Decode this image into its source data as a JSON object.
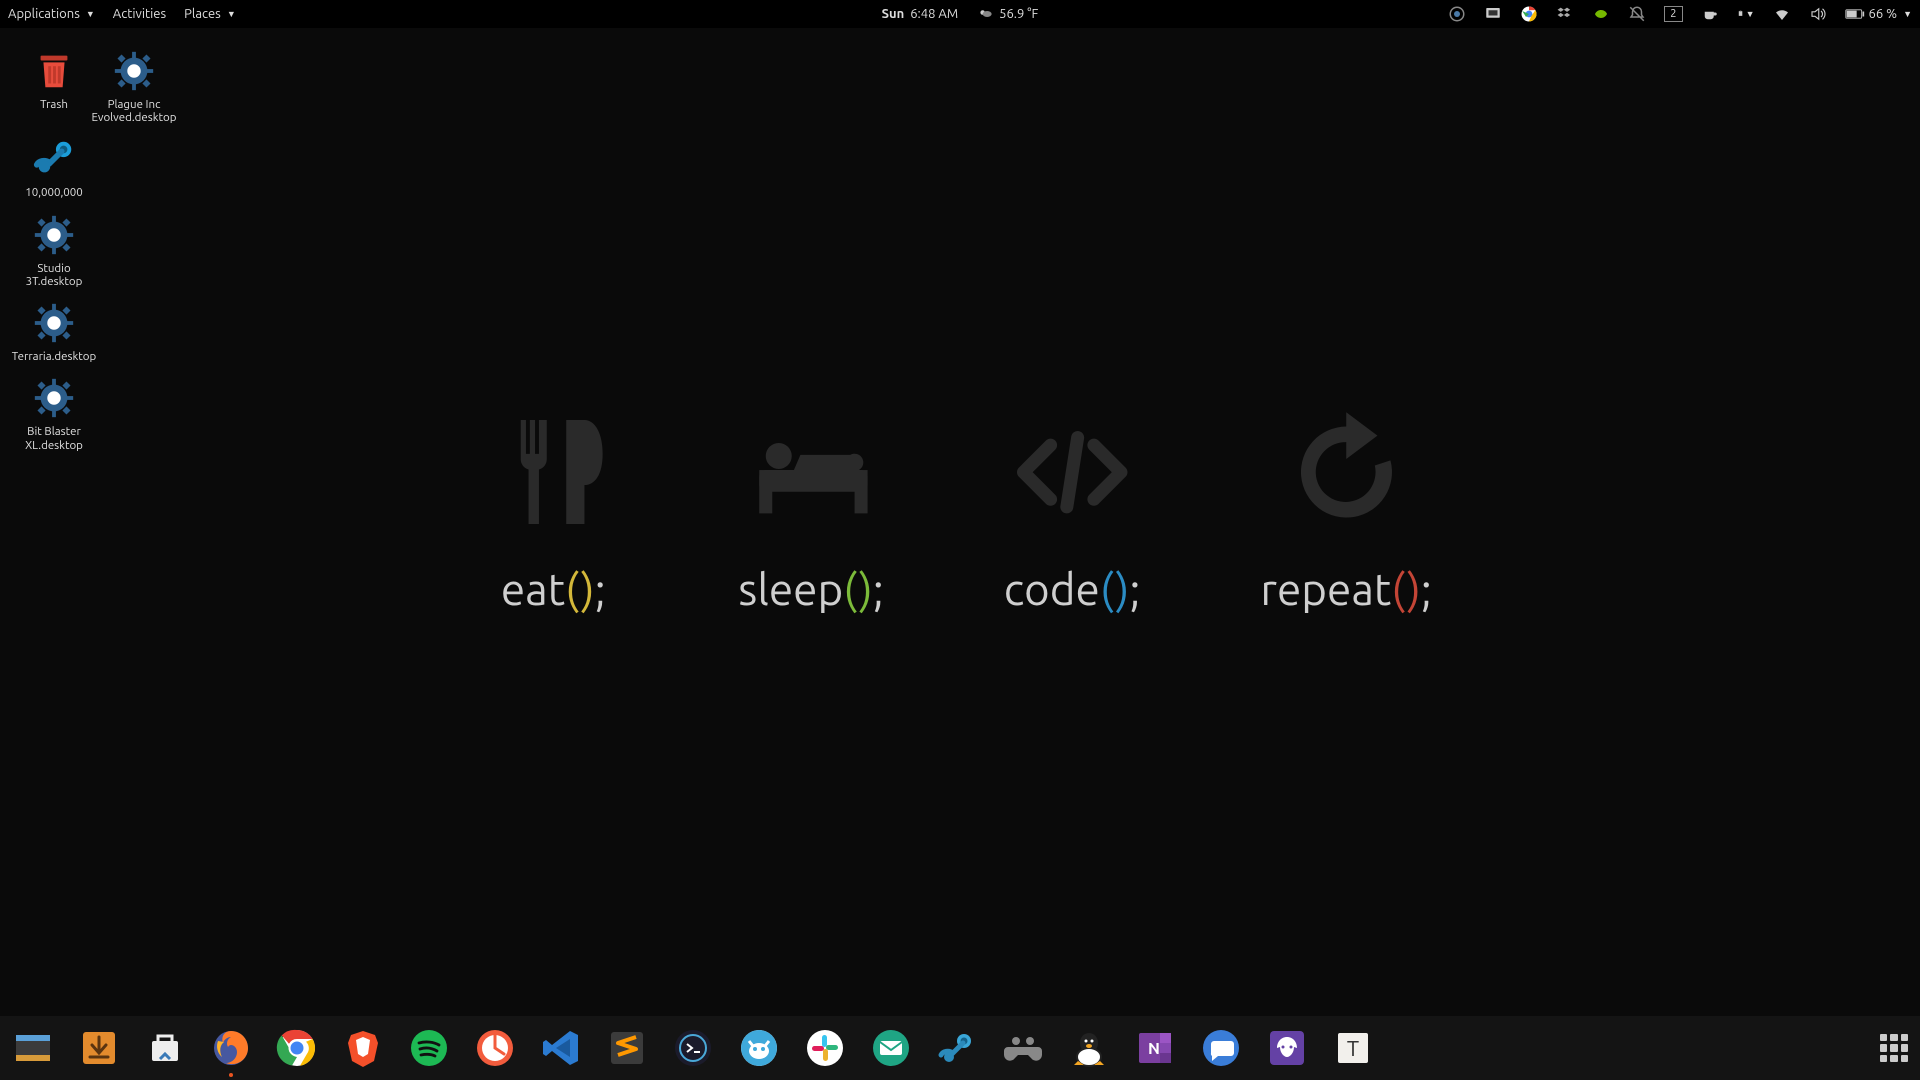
{
  "topbar": {
    "applications": "Applications",
    "activities": "Activities",
    "places": "Places",
    "day": "Sun",
    "time": "6:48 AM",
    "weather": "56.9 °F",
    "workspace": "2",
    "battery": "66 %"
  },
  "desktop_icons": [
    {
      "id": "trash",
      "label": "Trash"
    },
    {
      "id": "plague",
      "label": "Plague Inc Evolved.desktop"
    },
    {
      "id": "tenm",
      "label": "10,000,000"
    },
    {
      "id": "studio3t",
      "label": "Studio 3T.desktop"
    },
    {
      "id": "terraria",
      "label": "Terraria.desktop"
    },
    {
      "id": "bitblaster",
      "label": "Bit Blaster XL.desktop"
    }
  ],
  "wallpaper": [
    {
      "fn": "eat",
      "paren_color": "p-yellow"
    },
    {
      "fn": "sleep",
      "paren_color": "p-green"
    },
    {
      "fn": "code",
      "paren_color": "p-blue"
    },
    {
      "fn": "repeat",
      "paren_color": "p-red"
    }
  ],
  "dock": [
    {
      "id": "files",
      "name": "files-manager"
    },
    {
      "id": "download",
      "name": "download-manager"
    },
    {
      "id": "software",
      "name": "software-center"
    },
    {
      "id": "firefox",
      "name": "firefox",
      "running": true
    },
    {
      "id": "chrome",
      "name": "chrome"
    },
    {
      "id": "brave",
      "name": "brave"
    },
    {
      "id": "spotify",
      "name": "spotify"
    },
    {
      "id": "media",
      "name": "media-player"
    },
    {
      "id": "vscode",
      "name": "vscode"
    },
    {
      "id": "sublime",
      "name": "sublime-text"
    },
    {
      "id": "termius",
      "name": "termius"
    },
    {
      "id": "rambox",
      "name": "rambox"
    },
    {
      "id": "slack",
      "name": "slack"
    },
    {
      "id": "mail",
      "name": "mail-client"
    },
    {
      "id": "steam",
      "name": "steam"
    },
    {
      "id": "retroarch",
      "name": "retroarch"
    },
    {
      "id": "tux",
      "name": "supertux"
    },
    {
      "id": "onenote",
      "name": "onenote"
    },
    {
      "id": "messages",
      "name": "messages"
    },
    {
      "id": "gitkraken",
      "name": "gitkraken"
    },
    {
      "id": "typora",
      "name": "typora"
    }
  ]
}
